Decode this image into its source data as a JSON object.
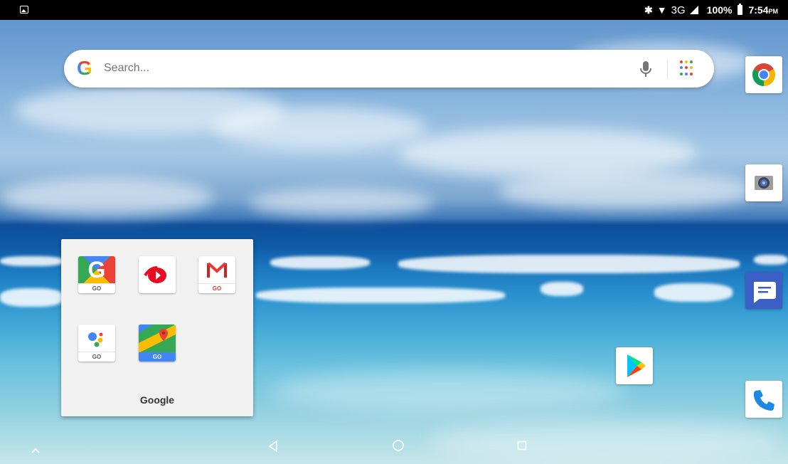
{
  "status_bar": {
    "network": "3G",
    "battery": "100%",
    "time": "7:54",
    "ampm": "PM"
  },
  "search": {
    "logo": "G",
    "placeholder": "Search..."
  },
  "folder": {
    "name": "Google",
    "apps": [
      {
        "icon": "google-go-icon",
        "badge": "GO"
      },
      {
        "icon": "youtube-go-icon",
        "badge": ""
      },
      {
        "icon": "gmail-go-icon",
        "badge": "GO"
      },
      {
        "icon": "assistant-go-icon",
        "badge": "GO"
      },
      {
        "icon": "maps-go-icon",
        "badge": "GO"
      }
    ]
  },
  "dock": [
    "chrome-icon",
    "camera-icon",
    "messages-icon",
    "phone-icon"
  ],
  "home_apps": [
    "play-store-icon"
  ],
  "navigation": [
    "app-drawer-arrow",
    "back-button",
    "home-button",
    "recents-button"
  ],
  "colors": {
    "google_blue": "#4285f4",
    "google_red": "#ea4335",
    "google_yellow": "#fbbc05",
    "google_green": "#34a853",
    "messages_blue": "#3b5fc4",
    "phone_blue": "#1e88e5"
  }
}
